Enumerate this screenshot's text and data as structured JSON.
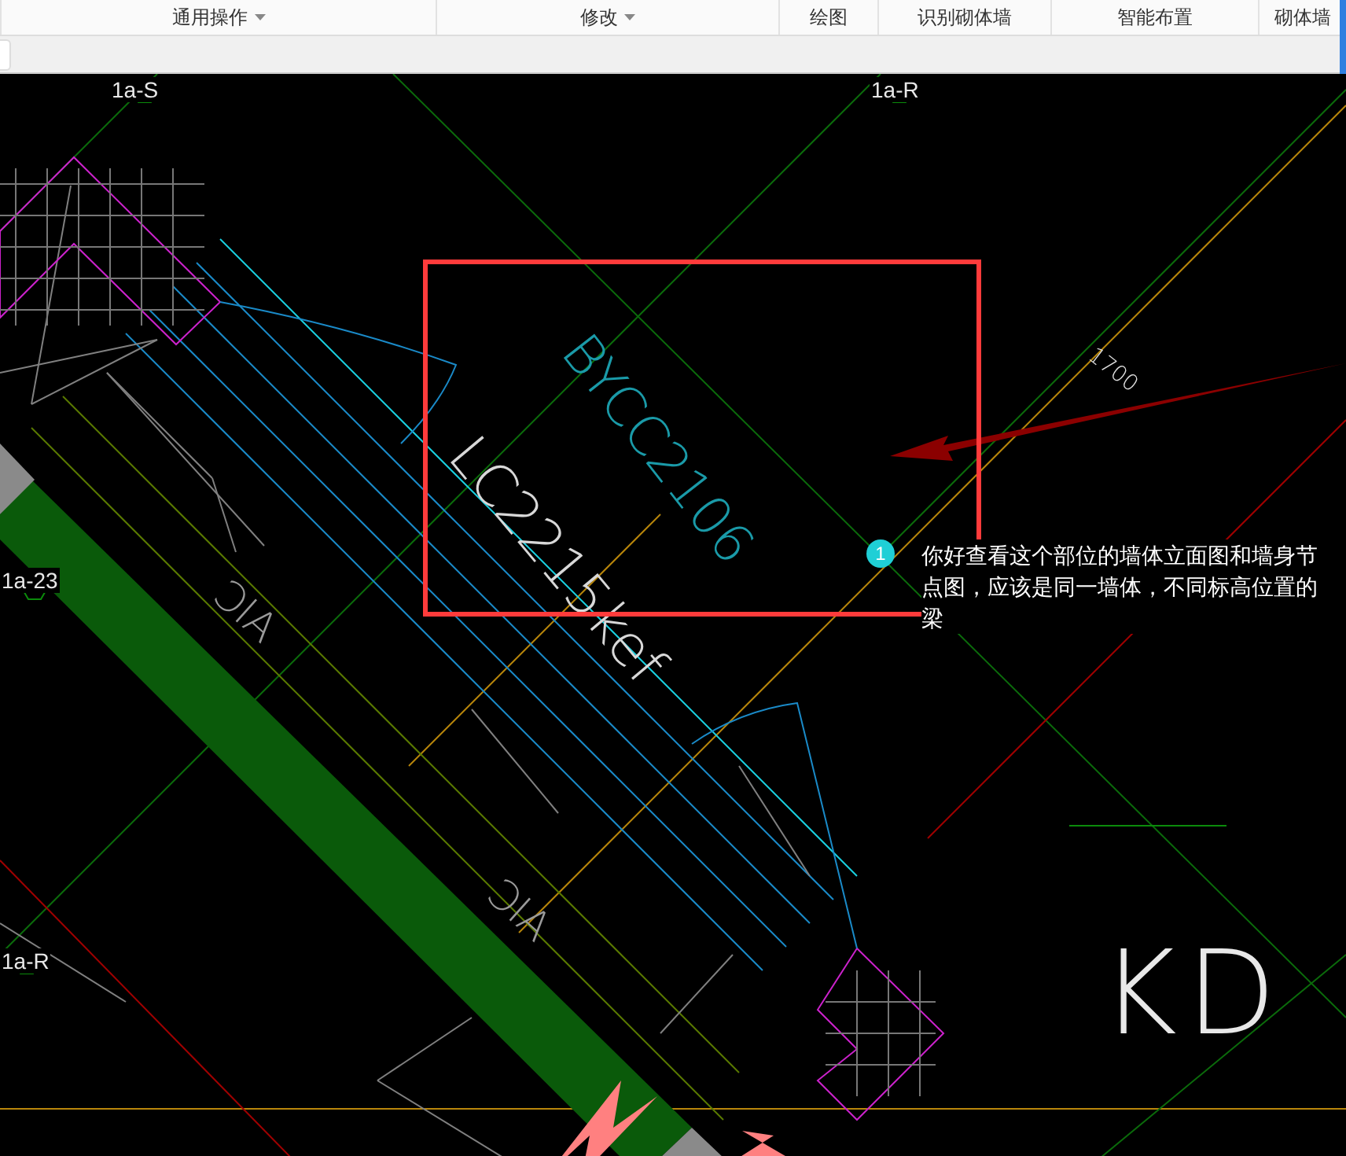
{
  "toolbar": {
    "groups": [
      {
        "label": "通用操作",
        "dropdown": true
      },
      {
        "label": "修改",
        "dropdown": true
      },
      {
        "label": "绘图",
        "dropdown": false
      },
      {
        "label": "识别砌体墙",
        "dropdown": false
      },
      {
        "label": "智能布置",
        "dropdown": false
      },
      {
        "label": "砌体墙",
        "dropdown": false
      }
    ]
  },
  "drawing": {
    "axis_labels": [
      "1a-S",
      "1a-R",
      "1a-23",
      "1a-R"
    ],
    "texts": [
      {
        "kind": "tag",
        "text": "BYCC2106"
      },
      {
        "kind": "tag",
        "text": "LC2215kef"
      },
      {
        "kind": "dimension",
        "text": "1700"
      },
      {
        "kind": "mark",
        "text": "ƆIA"
      },
      {
        "kind": "mark",
        "text": "ƆIA"
      },
      {
        "kind": "big",
        "text": "KD"
      }
    ]
  },
  "annotation": {
    "number": "1",
    "text": "你好查看这个部位的墙体立面图和墙身节点图，应该是同一墙体，不同标高位置的梁"
  }
}
